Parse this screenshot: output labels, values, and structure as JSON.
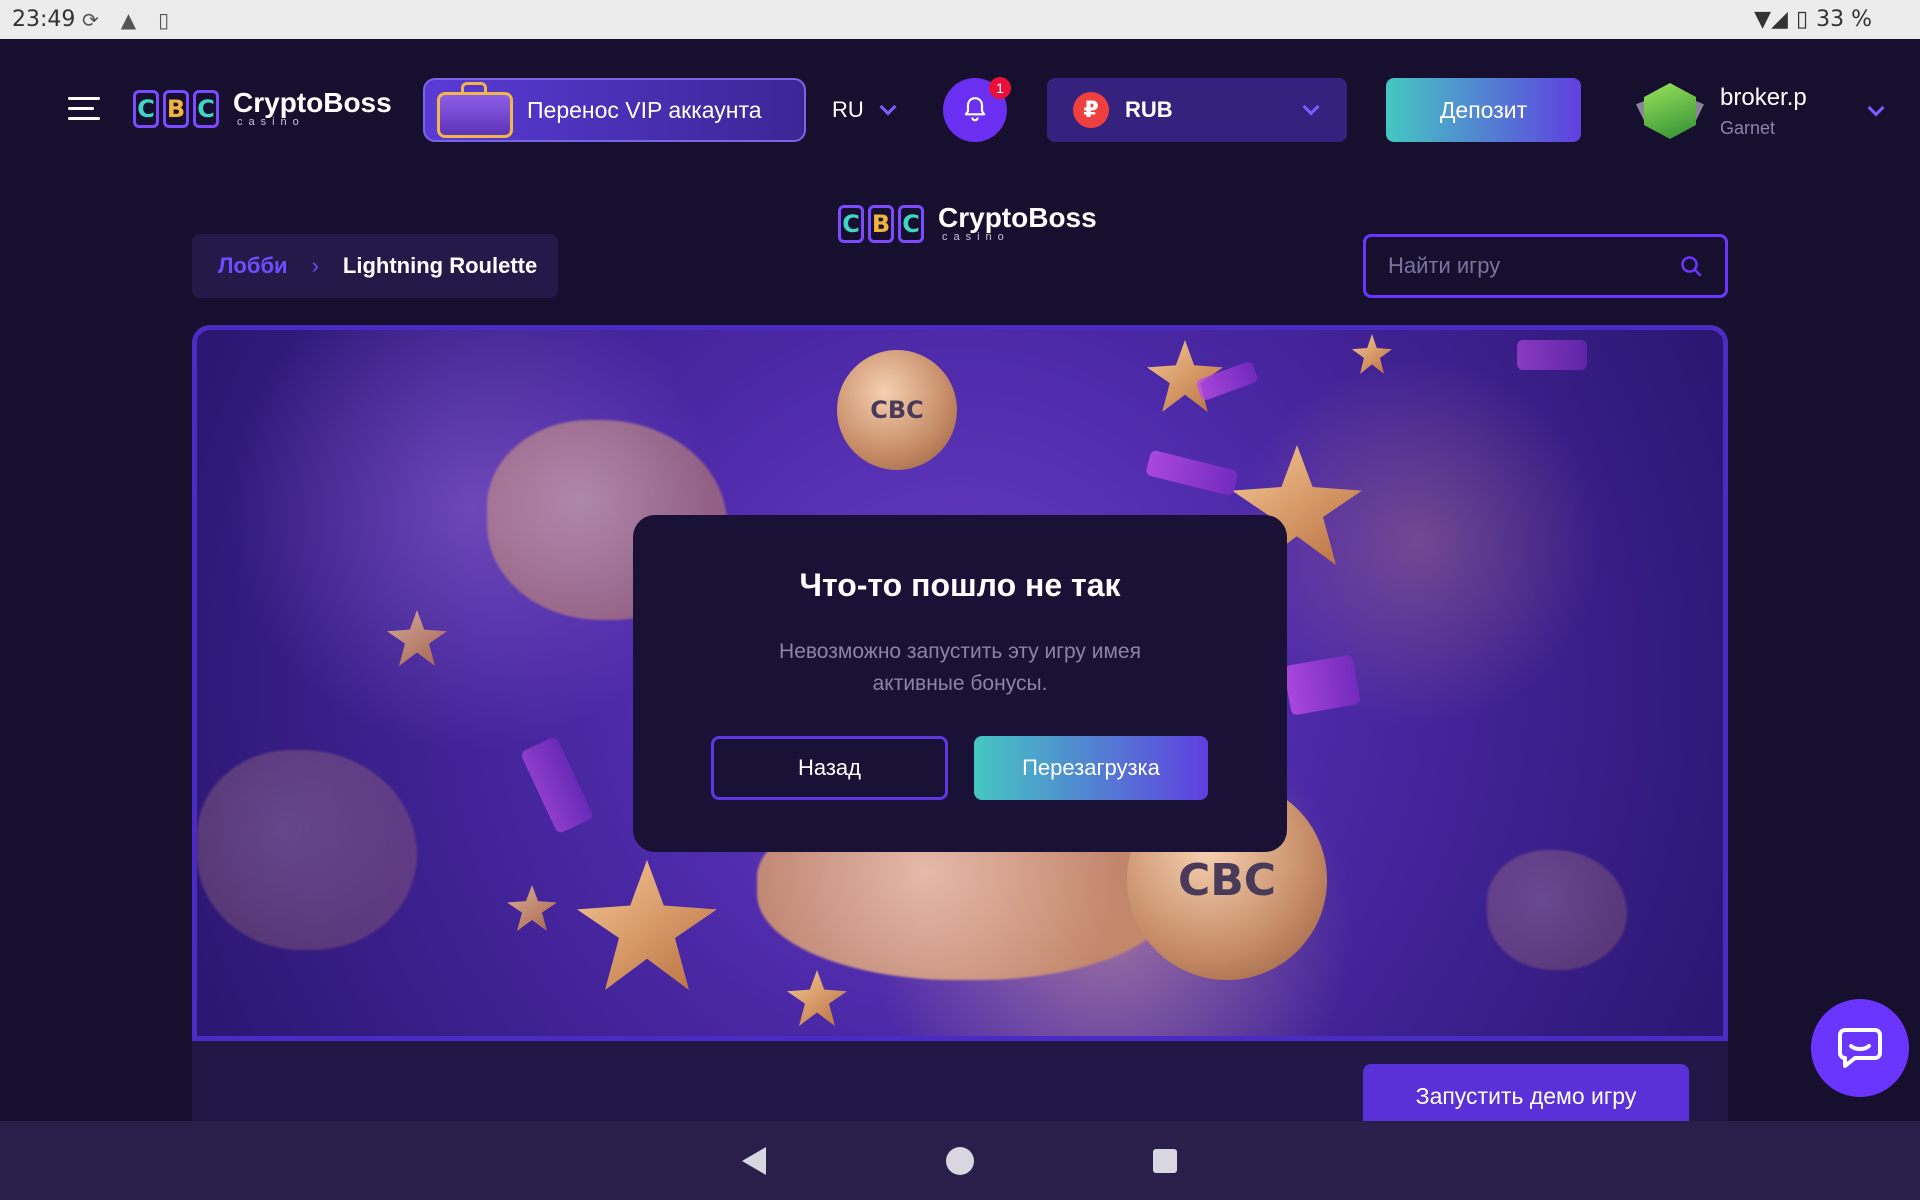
{
  "status_bar": {
    "time": "23:49",
    "battery": "33 %"
  },
  "header": {
    "logo": {
      "coins": [
        "C",
        "B",
        "C"
      ],
      "name": "CryptoBoss",
      "sub": "casino"
    },
    "vip_label": "Перенос VIP аккаунта",
    "language": "RU",
    "notifications_count": "1",
    "currency": {
      "symbol": "₽",
      "code": "RUB"
    },
    "deposit_label": "Депозит",
    "user": {
      "name": "broker.p",
      "rank": "Garnet"
    }
  },
  "breadcrumb": {
    "lobby": "Лобби",
    "separator": "›",
    "current": "Lightning Roulette"
  },
  "search": {
    "placeholder": "Найти игру"
  },
  "modal": {
    "title": "Что-то пошло не так",
    "message": "Невозможно запустить эту игру имея активные бонусы.",
    "back_label": "Назад",
    "reload_label": "Перезагрузка"
  },
  "demo_label": "Запустить демо игру",
  "coin_art_text": "CBC",
  "colors": {
    "accent": "#6a36ff",
    "teal": "#45c7c2",
    "background": "#16102e"
  }
}
